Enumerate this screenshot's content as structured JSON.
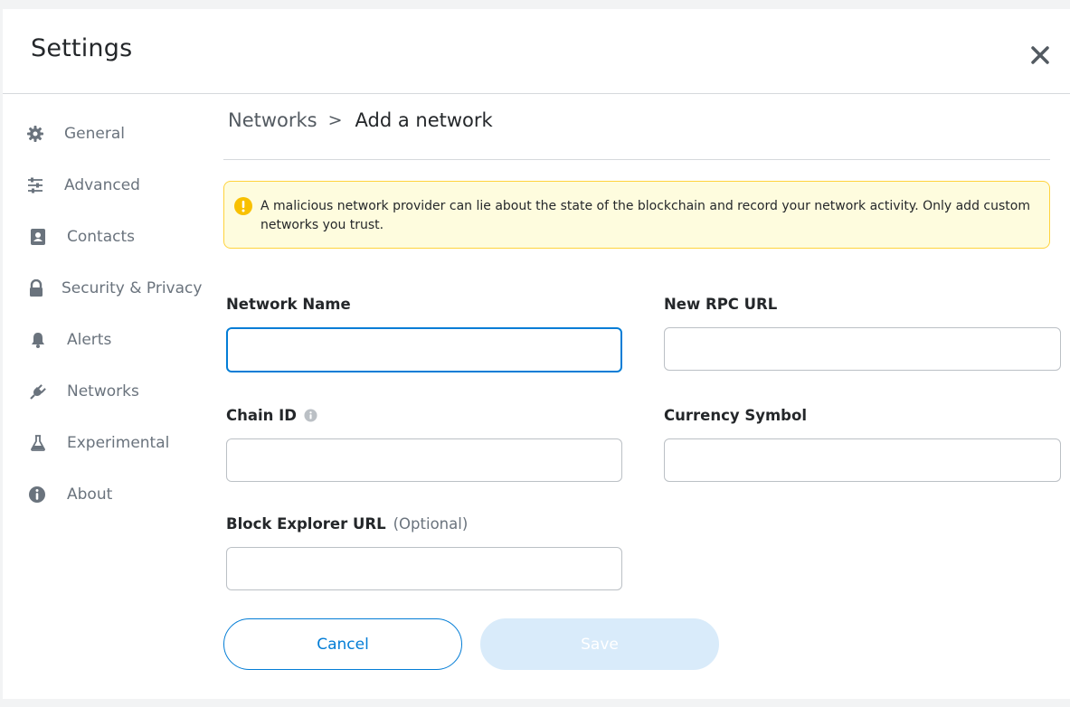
{
  "header": {
    "title": "Settings"
  },
  "sidebar": {
    "items": [
      {
        "label": "General",
        "icon": "gear-icon"
      },
      {
        "label": "Advanced",
        "icon": "sliders-icon"
      },
      {
        "label": "Contacts",
        "icon": "contacts-book-icon"
      },
      {
        "label": "Security & Privacy",
        "icon": "lock-icon"
      },
      {
        "label": "Alerts",
        "icon": "bell-icon"
      },
      {
        "label": "Networks",
        "icon": "plug-icon"
      },
      {
        "label": "Experimental",
        "icon": "flask-icon"
      },
      {
        "label": "About",
        "icon": "info-circle-icon"
      }
    ]
  },
  "breadcrumb": {
    "parent": "Networks",
    "separator": ">",
    "current": "Add a network"
  },
  "warning": {
    "text": "A malicious network provider can lie about the state of the blockchain and record your network activity. Only add custom networks you trust."
  },
  "form": {
    "network_name": {
      "label": "Network Name",
      "value": ""
    },
    "rpc_url": {
      "label": "New RPC URL",
      "value": ""
    },
    "chain_id": {
      "label": "Chain ID",
      "value": ""
    },
    "currency_symbol": {
      "label": "Currency Symbol",
      "value": ""
    },
    "block_explorer": {
      "label": "Block Explorer URL",
      "optional": "(Optional)",
      "value": ""
    }
  },
  "actions": {
    "cancel_label": "Cancel",
    "save_label": "Save"
  },
  "colors": {
    "accent": "#037dd6",
    "warning_bg": "#fefcde",
    "warning_border": "#ffd33d",
    "warning_icon": "#f8c000",
    "save_disabled": "#d9ebfa"
  }
}
